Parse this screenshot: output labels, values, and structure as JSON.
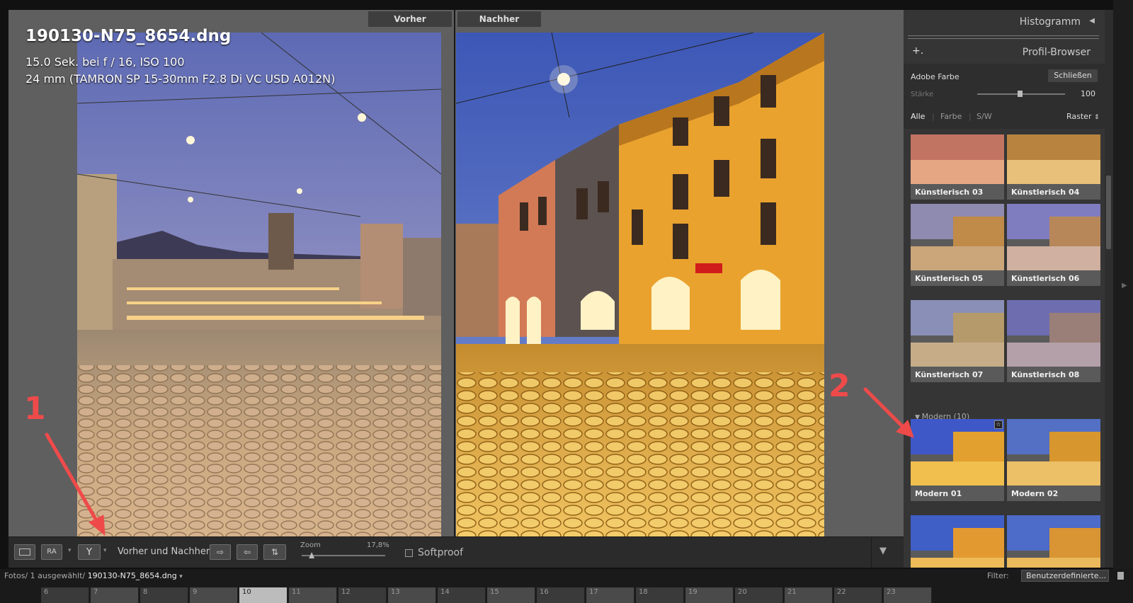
{
  "viewer": {
    "label_before": "Vorher",
    "label_after": "Nachher",
    "info": {
      "filename": "190130-N75_8654.dng",
      "exposure": "15.0 Sek. bei f / 16, ISO 100",
      "lens": "24 mm (TAMRON SP 15-30mm F2.8 Di VC USD A012N)"
    }
  },
  "toolbar": {
    "view_compare_label": "RA",
    "before_after_label": "Vorher und Nachher:",
    "zoom_label": "Zoom",
    "zoom_value": "17,8%",
    "zoom_fraction": 0.12,
    "softproof_label": "Softproof"
  },
  "panel": {
    "histogram_title": "Histogramm",
    "profile_browser_title": "Profil-Browser",
    "profile_name": "Adobe Farbe",
    "close_label": "Schließen",
    "amount_label": "Stärke",
    "amount_value": "100",
    "filter_tabs": [
      "Alle",
      "Farbe",
      "S/W"
    ],
    "view_mode": "Raster",
    "group_modern": "Modern (10)",
    "thumbs": [
      "Künstlerisch 03",
      "Künstlerisch 04",
      "Künstlerisch 05",
      "Künstlerisch 06",
      "Künstlerisch 07",
      "Künstlerisch 08",
      "Modern 01",
      "Modern 02"
    ],
    "favorite_badge": "☆"
  },
  "status": {
    "path": "Fotos/ 1 ausgewählt/",
    "filename": "190130-N75_8654.dng",
    "filter_label": "Filter:",
    "filter_value": "Benutzerdefinierte..."
  },
  "ruler": [
    "6",
    "7",
    "8",
    "9",
    "10",
    "11",
    "12",
    "13",
    "14",
    "15",
    "16",
    "17",
    "18",
    "19",
    "20",
    "21",
    "22",
    "23"
  ],
  "ruler_current": "10",
  "annotations": [
    "1",
    "2"
  ],
  "colors": {
    "accent_red": "#ef4a4a",
    "panel_bg": "#353535",
    "viewer_bg": "#5f5f5f"
  }
}
